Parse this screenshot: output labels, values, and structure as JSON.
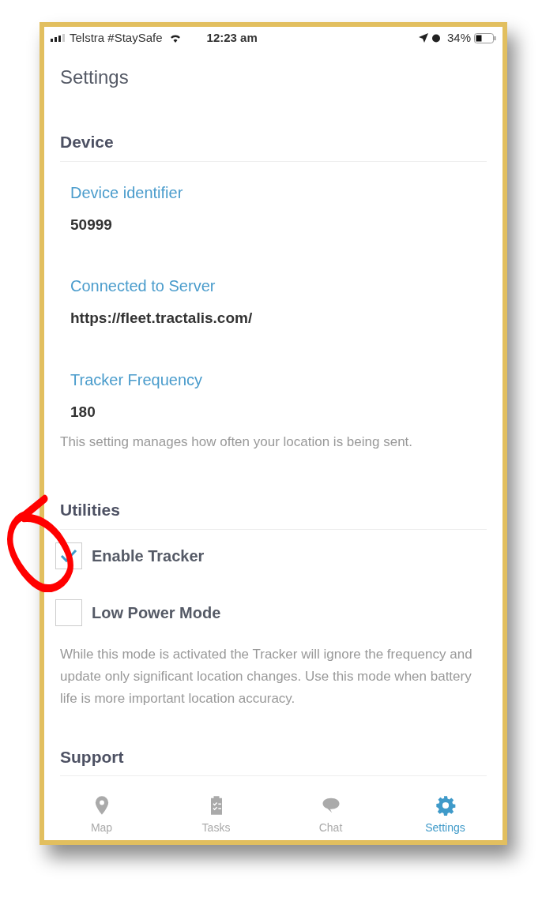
{
  "status_bar": {
    "carrier": "Telstra #StaySafe",
    "time": "12:23 am",
    "battery": "34%"
  },
  "title": "Settings",
  "sections": [
    {
      "heading": "Device",
      "items": [
        {
          "kind": "field",
          "label": "Device identifier",
          "value": "50999"
        },
        {
          "kind": "field",
          "label": "Connected to Server",
          "value": "https://fleet.tractalis.com/"
        },
        {
          "kind": "field",
          "label": "Tracker Frequency",
          "value": "180",
          "note": "This setting manages how often your location is being sent."
        }
      ]
    },
    {
      "heading": "Utilities",
      "items": [
        {
          "kind": "checkbox",
          "label": "Enable Tracker",
          "checked": true
        },
        {
          "kind": "checkbox",
          "label": "Low Power Mode",
          "checked": false,
          "note": "While this mode is activated the Tracker will ignore the frequency and update only significant location changes. Use this mode when battery life is more important location accuracy."
        }
      ]
    },
    {
      "heading": "Support"
    }
  ],
  "annotation": {
    "kind": "ring"
  },
  "tabs": [
    {
      "label": "Map",
      "selected": false
    },
    {
      "label": "Tasks",
      "selected": false
    },
    {
      "label": "Chat",
      "selected": false
    },
    {
      "label": "Settings",
      "selected": true
    }
  ]
}
